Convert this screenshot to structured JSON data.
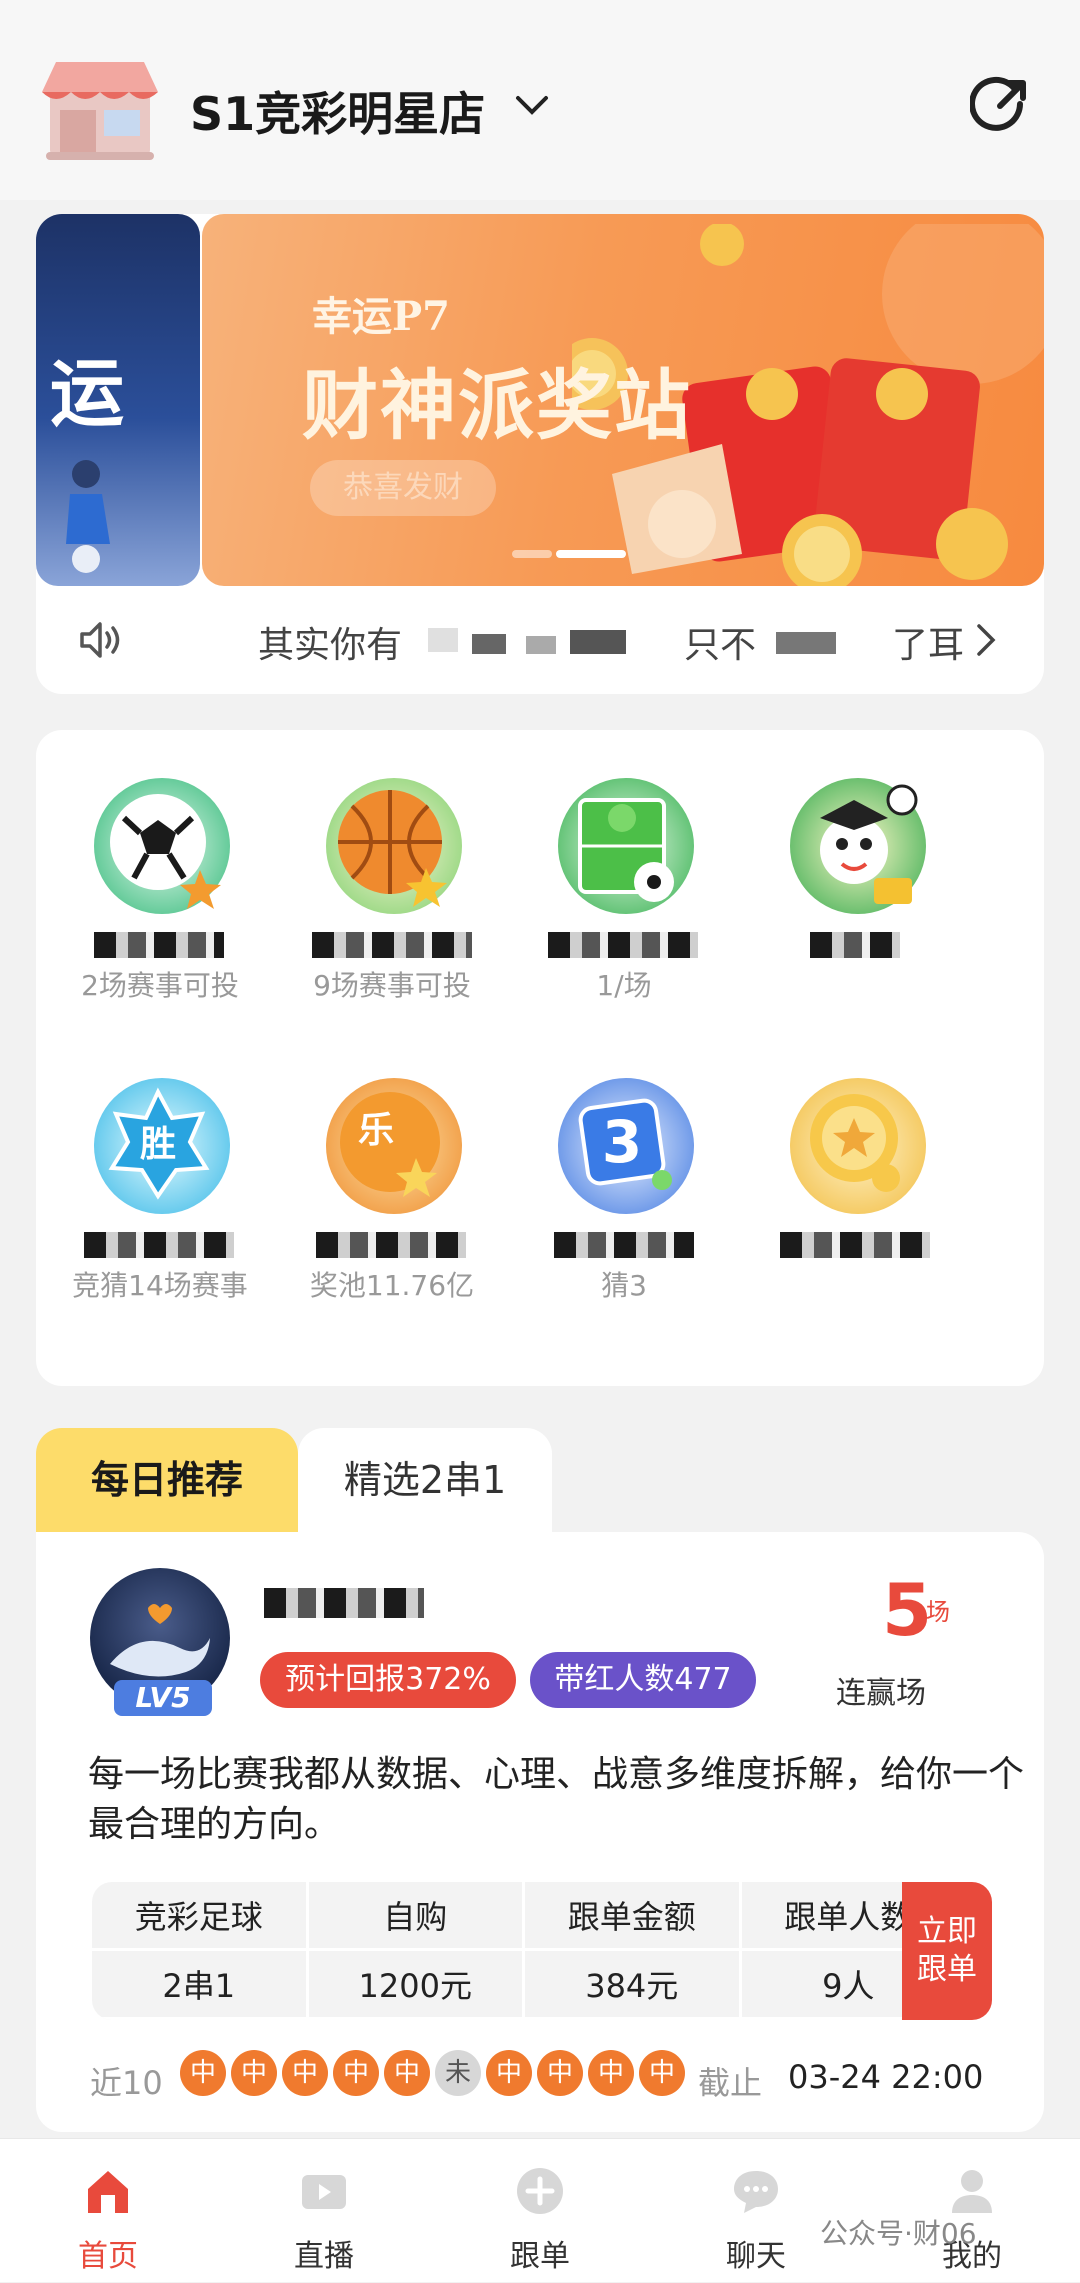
{
  "header": {
    "store_name": "S1竞彩明星店"
  },
  "banner": {
    "left_text": "运",
    "subtitle": "幸运P7",
    "title": "财神派奖站",
    "pill": "恭喜发财"
  },
  "notice": {
    "text_a": "其实你有",
    "text_b": "只不",
    "text_c": "了耳"
  },
  "games": [
    {
      "name": "",
      "sub": "2场赛事可投"
    },
    {
      "name": "",
      "sub": "9场赛事可投"
    },
    {
      "name": "",
      "sub": "1/场"
    },
    {
      "name": "",
      "sub": ""
    },
    {
      "name": "",
      "sub": "竞猜14场赛事"
    },
    {
      "name": "",
      "sub": "奖池11.76亿"
    },
    {
      "name": "",
      "sub": "猜3"
    },
    {
      "name": "",
      "sub": ""
    }
  ],
  "tabs": {
    "active": "每日推荐",
    "inactive": "精选2串1"
  },
  "recommend": {
    "expert_name": "",
    "level": "LV5",
    "return_badge": "预计回报372%",
    "followers_badge": "带红人数477",
    "streak_number": "5",
    "streak_unit": "场",
    "streak_label": "连赢场",
    "description": "每一场比赛我都从数据、心理、战意多维度拆解，给你一个最合理的方向。",
    "table": {
      "headers": [
        "竞彩足球",
        "自购",
        "跟单金额",
        "跟单人数"
      ],
      "values": [
        "2串1",
        "1200元",
        "384元",
        "9人"
      ]
    },
    "follow_button": "立即跟单",
    "recent_label": "近10",
    "recent_results": [
      "中",
      "中",
      "中",
      "中",
      "中",
      "未",
      "中",
      "中",
      "中",
      "中"
    ],
    "deadline_label": "截止",
    "deadline_time": "03-24 22:00"
  },
  "nav": [
    {
      "label": "首页",
      "icon": "home-icon"
    },
    {
      "label": "直播",
      "icon": "live-icon"
    },
    {
      "label": "跟单",
      "icon": "plus-circle-icon"
    },
    {
      "label": "聊天",
      "icon": "chat-icon"
    },
    {
      "label": "我的",
      "icon": "user-icon"
    }
  ],
  "watermark": "公众号·财06",
  "colors": {
    "accent": "#e84a3c",
    "tab_active": "#fddc6a",
    "badge_purple": "#6a52c9",
    "result_orange": "#f07a2e"
  }
}
